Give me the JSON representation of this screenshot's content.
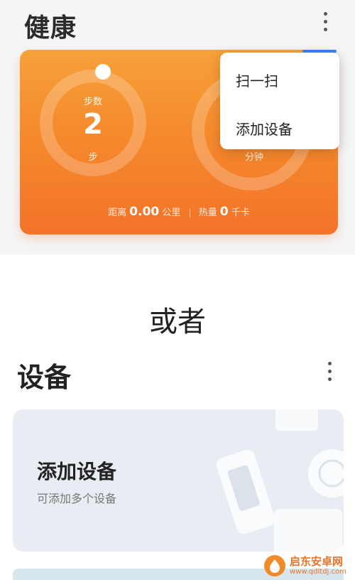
{
  "health": {
    "title": "健康",
    "steps_label": "步数",
    "steps_value": "2",
    "steps_unit": "步",
    "time_unit": "分钟",
    "stats": {
      "distance_label": "距离",
      "distance_value": "0.00",
      "distance_unit": "公里",
      "calories_label": "热量",
      "calories_value": "0",
      "calories_unit": "千卡"
    }
  },
  "menu": {
    "items": [
      {
        "label": "扫一扫"
      },
      {
        "label": "添加设备"
      }
    ]
  },
  "or_text": "或者",
  "devices": {
    "title": "设备",
    "card_title": "添加设备",
    "card_subtitle": "可添加多个设备"
  },
  "watermark": {
    "name": "启东安卓网",
    "url": "www.qdltdj.com"
  },
  "colors": {
    "card_orange": "#f58a2c",
    "menu_accent": "#3b82f6",
    "device_card_bg": "#e9edf3"
  },
  "icons": [
    "more-vert-icon",
    "more-vert-icon",
    "device-illustration",
    "watermark-logo-icon"
  ]
}
